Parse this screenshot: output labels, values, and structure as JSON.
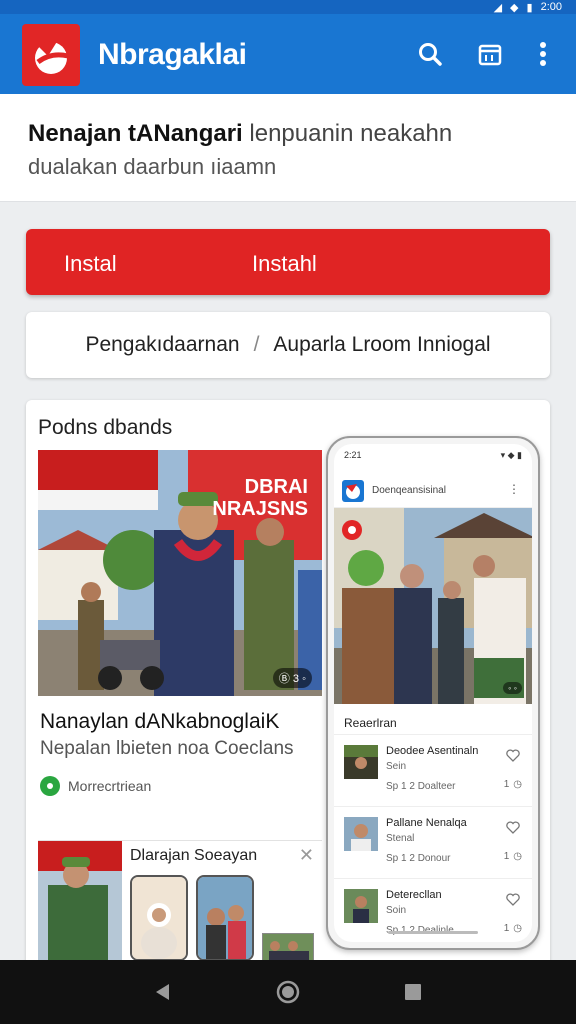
{
  "status_bar": {
    "time": "2:00"
  },
  "app_bar": {
    "title": "Nbragaklai",
    "actions": [
      "search-icon",
      "calendar-icon",
      "more-vert-icon"
    ],
    "color": "#1976d2",
    "logo_color": "#e12626"
  },
  "header": {
    "title_bold": "Nenajan tANangari",
    "title_rest": "lenpuanin neakahn",
    "description": "dualakan daarbun ıiaamn"
  },
  "install": {
    "label_left": "Instal",
    "label_right": "Instahl",
    "color": "#e02424"
  },
  "path": {
    "left": "Pengakıdaarnan",
    "separator": "/",
    "right": "Auparla Lroom Inniogal"
  },
  "content": {
    "section_title": "Podns dbands",
    "hero": {
      "banner_text": "DBRAI NRAJSNS",
      "badge": "Ⓑ 3 ◦"
    },
    "article": {
      "title": "Nanaylan dANkabnoglaiK",
      "subtitle": "Nepalan lbieten noa Coeclans",
      "source": "Morrecrtriean"
    },
    "mini": {
      "title": "Dlarajan Soeayan"
    },
    "phone": {
      "time": "2:21",
      "app_title": "Doenqeansisinal",
      "section": "Reaerlran",
      "items": [
        {
          "title": "Deodee Asentinaln",
          "sub": "Sein",
          "meta": "Sp 1 2 Doalteer",
          "count": "1"
        },
        {
          "title": "Pallane Nenalqa",
          "sub": "Stenal",
          "meta": "Sp 1 2 Donour",
          "count": "1"
        },
        {
          "title": "Deterecllan",
          "sub": "Soin",
          "meta": "Sp 1 2 Dealinle",
          "count": "1"
        }
      ]
    }
  },
  "nav": [
    "back-icon",
    "home-icon",
    "recents-icon"
  ]
}
